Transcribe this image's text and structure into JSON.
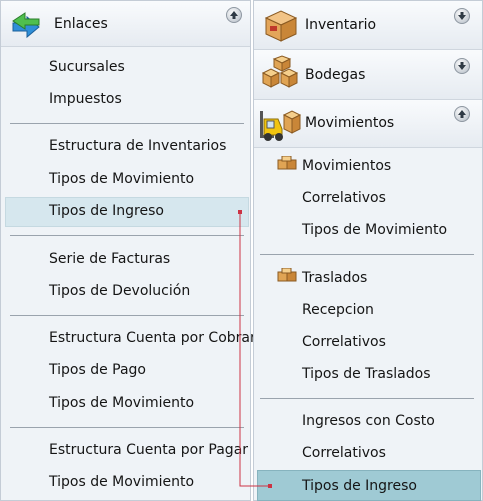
{
  "left_panel": {
    "header": {
      "title": "Enlaces",
      "icon": "link-arrows-icon",
      "toggle": "collapse-up-icon"
    },
    "groups": [
      {
        "items": [
          "Sucursales",
          "Impuestos"
        ]
      },
      {
        "items": [
          "Estructura de Inventarios",
          "Tipos de Movimiento",
          "Tipos de Ingreso"
        ]
      },
      {
        "items": [
          "Serie de Facturas",
          "Tipos de Devolución"
        ]
      },
      {
        "items": [
          "Estructura Cuenta por Cobrar",
          "Tipos de Pago",
          "Tipos de Movimiento"
        ]
      },
      {
        "items": [
          "Estructura Cuenta por Pagar",
          "Tipos de Movimiento"
        ]
      }
    ],
    "selected_item": "Tipos de Ingreso"
  },
  "right_panel": {
    "headers": [
      {
        "title": "Inventario",
        "icon": "box-icon",
        "toggle": "expand-down-icon"
      },
      {
        "title": "Bodegas",
        "icon": "boxes-stack-icon",
        "toggle": "expand-down-icon"
      },
      {
        "title": "Movimientos",
        "icon": "forklift-icon",
        "toggle": "collapse-up-icon"
      }
    ],
    "groups": [
      {
        "title": "Movimientos",
        "icon": "small-boxes-icon",
        "items": [
          "Correlativos",
          "Tipos de Movimiento"
        ]
      },
      {
        "title": "Traslados",
        "icon": "small-boxes-icon",
        "items": [
          "Recepcion",
          "Correlativos",
          "Tipos de Traslados"
        ]
      },
      {
        "items": [
          "Ingresos con Costo",
          "Correlativos",
          "Tipos de Ingreso"
        ]
      }
    ],
    "selected_item": "Tipos de Ingreso"
  },
  "colors": {
    "panel_bg": "#eff3f7",
    "selected_left": "#d6e7ee",
    "selected_right": "#9fcad4",
    "connector": "#cc3344"
  }
}
